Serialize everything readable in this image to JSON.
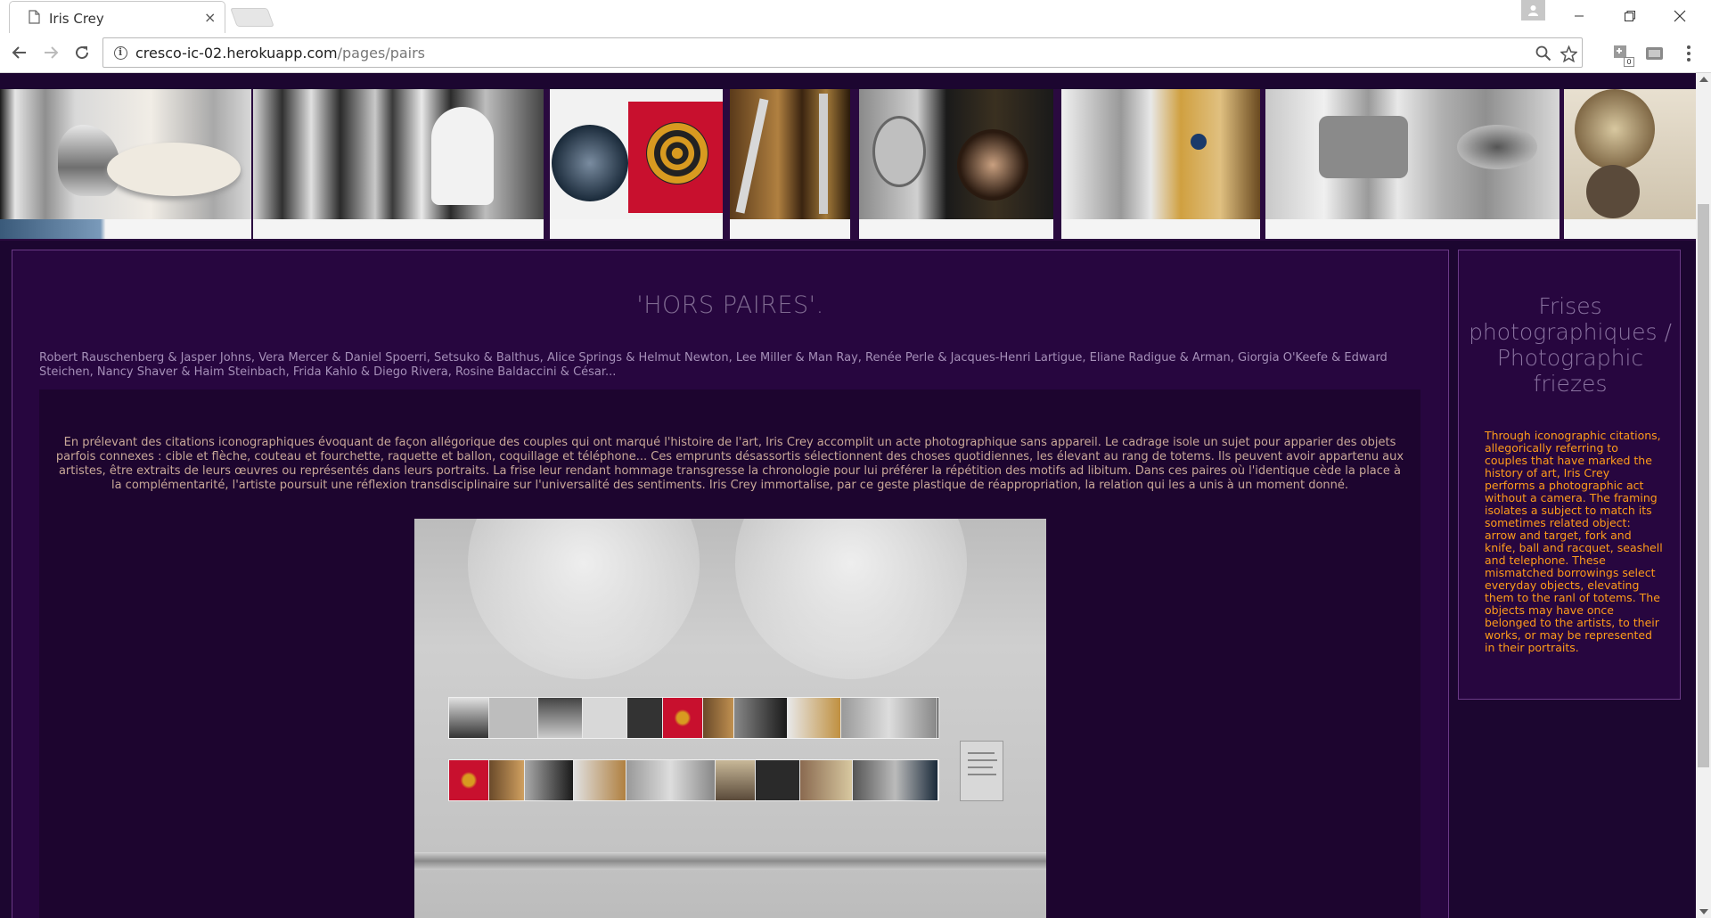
{
  "browser": {
    "tab_title": "Iris Crey",
    "tab_close": "×",
    "url_host": "cresco-ic-02.herokuapp.com",
    "url_path": "/pages/pairs",
    "extension_badge": "0"
  },
  "page": {
    "title": "'HORS PAIRES'.",
    "artists": "Robert Rauschenberg & Jasper Johns, Vera Mercer & Daniel Spoerri, Setsuko & Balthus, Alice Springs & Helmut Newton, Lee Miller & Man Ray, Renée Perle & Jacques-Henri Lartigue, Eliane Radigue & Arman, Giorgia O'Keefe & Edward Steichen, Nancy Shaver & Haim Steinbach, Frida Kahlo & Diego Rivera, Rosine Baldaccini & César...",
    "intro": "En prélevant des citations iconographiques évoquant de façon allégorique des couples qui ont marqué l'histoire de l'art, Iris Crey accomplit un acte photographique sans appareil. Le cadrage isole un sujet pour apparier des objets parfois connexes : cible et flèche, couteau et fourchette, raquette et ballon, coquillage et téléphone... Ces emprunts désassortis sélectionnent des choses quotidiennes, les élevant au rang de totems. Ils peuvent avoir appartenu aux artistes, être extraits de leurs œuvres ou représentés dans leurs portraits. La frise leur rendant hommage transgresse la chronologie pour lui préférer la répétition des motifs ad libitum. Dans ces paires où l'identique cède la place à la complémentarité, l'artiste poursuit une réflexion transdisciplinaire sur l'universalité des sentiments. Iris Crey immortalise, par ce geste plastique de réappropriation, la relation qui les a unis à un moment donné."
  },
  "sidebar": {
    "title": "Frises photographiques / Photographic friezes",
    "text": "Through iconographic citations, allegorically referring to couples that have marked the history of art, Iris Crey performs a photographic act without a camera. The framing isolates a subject to match its sometimes related object: arrow and target, fork and knife, ball and racquet, seashell and telephone. These mismatched borrowings select everyday objects, elevating them to the ranl of totems. The objects may have once belonged to the artists, to their works, or may be represented in their portraits."
  },
  "colors": {
    "page_bg": "#1c0630",
    "panel_bg": "#27063f",
    "panel_border": "#6a3a86",
    "title": "#7f6a91",
    "artists_text": "#a58fb8",
    "intro_text": "#c9a898",
    "side_text": "#ff9c1a"
  }
}
